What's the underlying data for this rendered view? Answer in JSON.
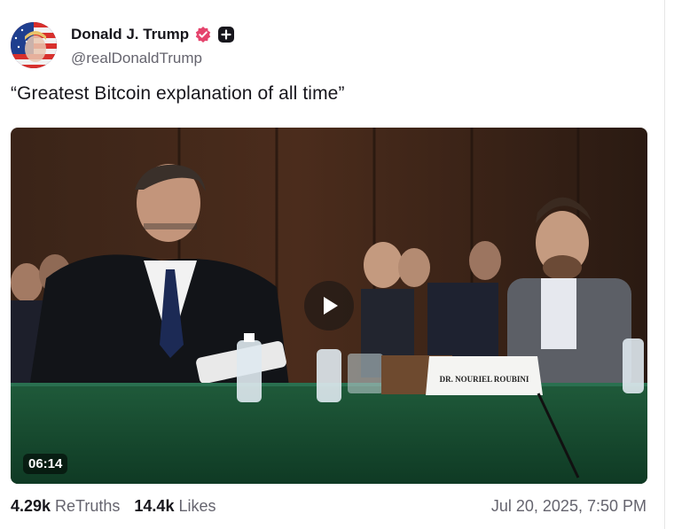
{
  "author": {
    "name": "Donald J. Trump",
    "handle": "@realDonaldTrump",
    "verified_icon": "verified-badge-icon",
    "follow_icon": "plus-icon"
  },
  "post": {
    "text": "“Greatest Bitcoin explanation of all time”",
    "video": {
      "duration": "06:14",
      "nameplate": "DR. NOURIEL ROUBINI",
      "play_icon": "play-icon"
    }
  },
  "stats": {
    "retruths_count": "4.29k",
    "retruths_label": "ReTruths",
    "likes_count": "14.4k",
    "likes_label": "Likes"
  },
  "timestamp": "Jul 20, 2025, 7:50 PM",
  "colors": {
    "text": "#17161c",
    "muted": "#65646e",
    "verified": "#e5446d"
  }
}
